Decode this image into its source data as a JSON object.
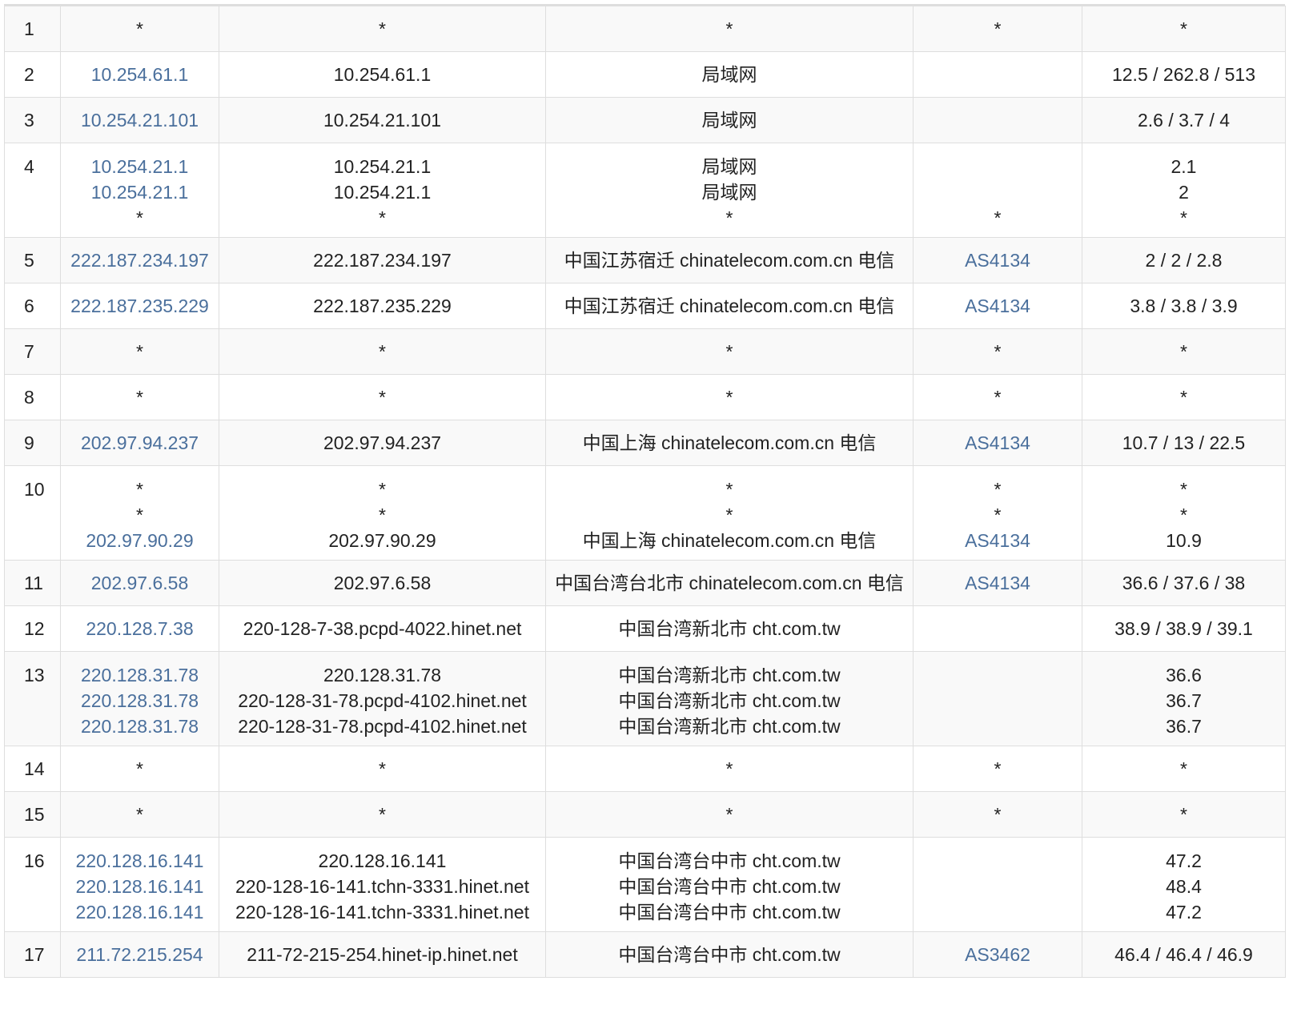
{
  "rows": [
    {
      "num": "1",
      "ip": [
        "*"
      ],
      "host": [
        "*"
      ],
      "loc": [
        "*"
      ],
      "asn": [
        "*"
      ],
      "rtt": [
        "*"
      ]
    },
    {
      "num": "2",
      "ip": [
        "10.254.61.1"
      ],
      "host": [
        "10.254.61.1"
      ],
      "loc": [
        "局域网"
      ],
      "asn": [
        ""
      ],
      "rtt": [
        "12.5 / 262.8 / 513"
      ]
    },
    {
      "num": "3",
      "ip": [
        "10.254.21.101"
      ],
      "host": [
        "10.254.21.101"
      ],
      "loc": [
        "局域网"
      ],
      "asn": [
        ""
      ],
      "rtt": [
        "2.6 / 3.7 / 4"
      ]
    },
    {
      "num": "4",
      "ip": [
        "10.254.21.1",
        "10.254.21.1",
        "*"
      ],
      "host": [
        "10.254.21.1",
        "10.254.21.1",
        "*"
      ],
      "loc": [
        "局域网",
        "局域网",
        "*"
      ],
      "asn": [
        "",
        "",
        "*"
      ],
      "rtt": [
        "2.1",
        "2",
        "*"
      ]
    },
    {
      "num": "5",
      "ip": [
        "222.187.234.197"
      ],
      "host": [
        "222.187.234.197"
      ],
      "loc": [
        "中国江苏宿迁 chinatelecom.com.cn 电信"
      ],
      "asn": [
        "AS4134"
      ],
      "rtt": [
        "2 / 2 / 2.8"
      ]
    },
    {
      "num": "6",
      "ip": [
        "222.187.235.229"
      ],
      "host": [
        "222.187.235.229"
      ],
      "loc": [
        "中国江苏宿迁 chinatelecom.com.cn 电信"
      ],
      "asn": [
        "AS4134"
      ],
      "rtt": [
        "3.8 / 3.8 / 3.9"
      ]
    },
    {
      "num": "7",
      "ip": [
        "*"
      ],
      "host": [
        "*"
      ],
      "loc": [
        "*"
      ],
      "asn": [
        "*"
      ],
      "rtt": [
        "*"
      ]
    },
    {
      "num": "8",
      "ip": [
        "*"
      ],
      "host": [
        "*"
      ],
      "loc": [
        "*"
      ],
      "asn": [
        "*"
      ],
      "rtt": [
        "*"
      ]
    },
    {
      "num": "9",
      "ip": [
        "202.97.94.237"
      ],
      "host": [
        "202.97.94.237"
      ],
      "loc": [
        "中国上海 chinatelecom.com.cn 电信"
      ],
      "asn": [
        "AS4134"
      ],
      "rtt": [
        "10.7 / 13 / 22.5"
      ]
    },
    {
      "num": "10",
      "ip": [
        "*",
        "*",
        "202.97.90.29"
      ],
      "host": [
        "*",
        "*",
        "202.97.90.29"
      ],
      "loc": [
        "*",
        "*",
        "中国上海 chinatelecom.com.cn 电信"
      ],
      "asn": [
        "*",
        "*",
        "AS4134"
      ],
      "rtt": [
        "*",
        "*",
        "10.9"
      ]
    },
    {
      "num": "11",
      "ip": [
        "202.97.6.58"
      ],
      "host": [
        "202.97.6.58"
      ],
      "loc": [
        "中国台湾台北市 chinatelecom.com.cn 电信"
      ],
      "asn": [
        "AS4134"
      ],
      "rtt": [
        "36.6 / 37.6 / 38"
      ]
    },
    {
      "num": "12",
      "ip": [
        "220.128.7.38"
      ],
      "host": [
        "220-128-7-38.pcpd-4022.hinet.net"
      ],
      "loc": [
        "中国台湾新北市 cht.com.tw"
      ],
      "asn": [
        ""
      ],
      "rtt": [
        "38.9 / 38.9 / 39.1"
      ]
    },
    {
      "num": "13",
      "ip": [
        "220.128.31.78",
        "220.128.31.78",
        "220.128.31.78"
      ],
      "host": [
        "220.128.31.78",
        "220-128-31-78.pcpd-4102.hinet.net",
        "220-128-31-78.pcpd-4102.hinet.net"
      ],
      "loc": [
        "中国台湾新北市 cht.com.tw",
        "中国台湾新北市 cht.com.tw",
        "中国台湾新北市 cht.com.tw"
      ],
      "asn": [
        "",
        "",
        ""
      ],
      "rtt": [
        "36.6",
        "36.7",
        "36.7"
      ]
    },
    {
      "num": "14",
      "ip": [
        "*"
      ],
      "host": [
        "*"
      ],
      "loc": [
        "*"
      ],
      "asn": [
        "*"
      ],
      "rtt": [
        "*"
      ]
    },
    {
      "num": "15",
      "ip": [
        "*"
      ],
      "host": [
        "*"
      ],
      "loc": [
        "*"
      ],
      "asn": [
        "*"
      ],
      "rtt": [
        "*"
      ]
    },
    {
      "num": "16",
      "ip": [
        "220.128.16.141",
        "220.128.16.141",
        "220.128.16.141"
      ],
      "host": [
        "220.128.16.141",
        "220-128-16-141.tchn-3331.hinet.net",
        "220-128-16-141.tchn-3331.hinet.net"
      ],
      "loc": [
        "中国台湾台中市 cht.com.tw",
        "中国台湾台中市 cht.com.tw",
        "中国台湾台中市 cht.com.tw"
      ],
      "asn": [
        "",
        "",
        ""
      ],
      "rtt": [
        "47.2",
        "48.4",
        "47.2"
      ]
    },
    {
      "num": "17",
      "ip": [
        "211.72.215.254"
      ],
      "host": [
        "211-72-215-254.hinet-ip.hinet.net"
      ],
      "loc": [
        "中国台湾台中市 cht.com.tw"
      ],
      "asn": [
        "AS3462"
      ],
      "rtt": [
        "46.4 / 46.4 / 46.9"
      ]
    }
  ]
}
